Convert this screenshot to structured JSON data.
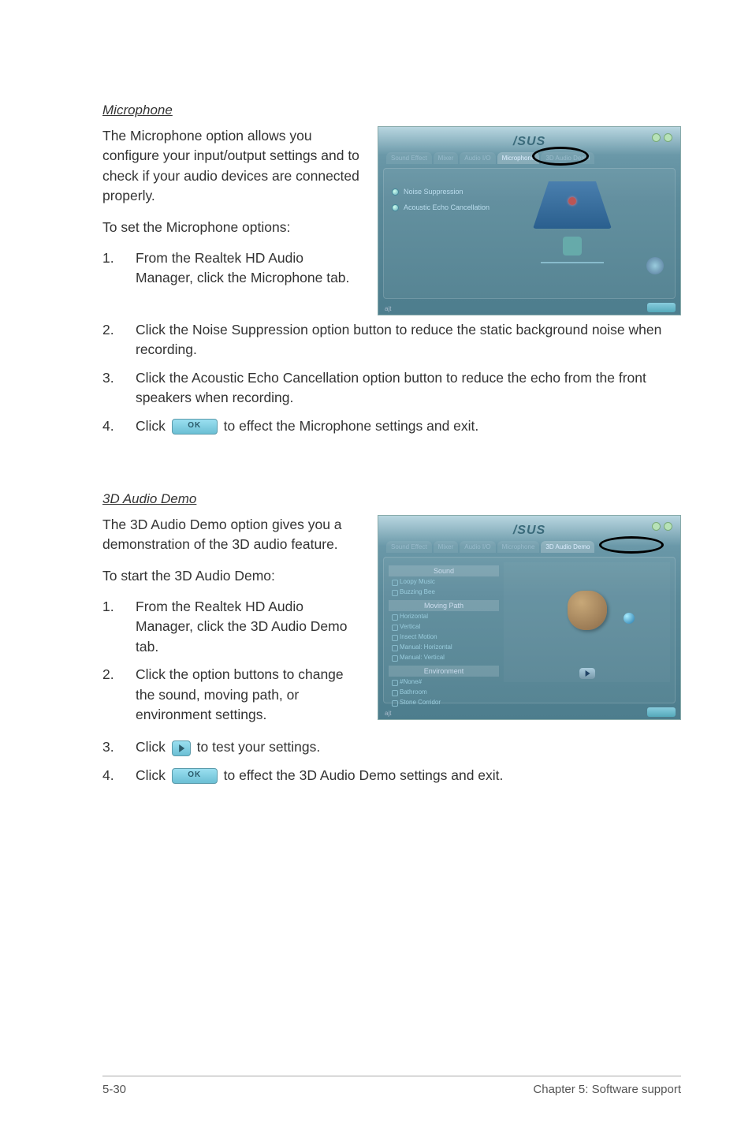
{
  "microphone": {
    "heading": "Microphone",
    "intro": "The Microphone option allows you configure your input/output settings and to check if your audio devices are connected properly.",
    "toSet": "To set the Microphone options:",
    "steps": [
      "From the Realtek HD Audio Manager, click the Microphone tab.",
      "Click the Noise Suppression option button to reduce the static background noise when recording.",
      "Click the Acoustic Echo Cancellation option button to reduce the echo from the front speakers when recording.",
      " to effect the Microphone settings and exit."
    ],
    "step4prefix": "Click ",
    "screenshot": {
      "logo": "/SUS",
      "tabs": [
        "Sound Effect",
        "Mixer",
        "Audio I/O",
        "Microphone",
        "3D Audio Demo"
      ],
      "options": [
        "Noise Suppression",
        "Acoustic Echo Cancellation"
      ],
      "footer": "ajt"
    }
  },
  "demo3d": {
    "heading": "3D Audio Demo",
    "intro": "The 3D Audio Demo option gives you a demonstration of the 3D audio feature.",
    "toStart": "To start the 3D Audio Demo:",
    "steps": [
      "From the Realtek HD Audio Manager, click the 3D Audio Demo tab.",
      "Click the option buttons to change the sound, moving path, or environment settings.",
      " to test your settings.",
      " to effect the 3D Audio Demo settings and exit."
    ],
    "step3prefix": "Click ",
    "step4prefix": "Click ",
    "screenshot": {
      "logo": "/SUS",
      "tabs": [
        "Sound Effect",
        "Mixer",
        "Audio I/O",
        "Microphone",
        "3D Audio Demo"
      ],
      "panels": {
        "sound_head": "Sound",
        "sound_items": [
          "Loopy Music",
          "Buzzing Bee"
        ],
        "path_head": "Moving Path",
        "path_items": [
          "Horizontal",
          "Vertical",
          "Insect Motion",
          "Manual: Horizontal",
          "Manual: Vertical"
        ],
        "env_head": "Environment",
        "env_items": [
          "#None#",
          "Bathroom",
          "Stone Corridor"
        ]
      },
      "footer": "ajt"
    }
  },
  "footer": {
    "left": "5-30",
    "right": "Chapter 5: Software support"
  }
}
